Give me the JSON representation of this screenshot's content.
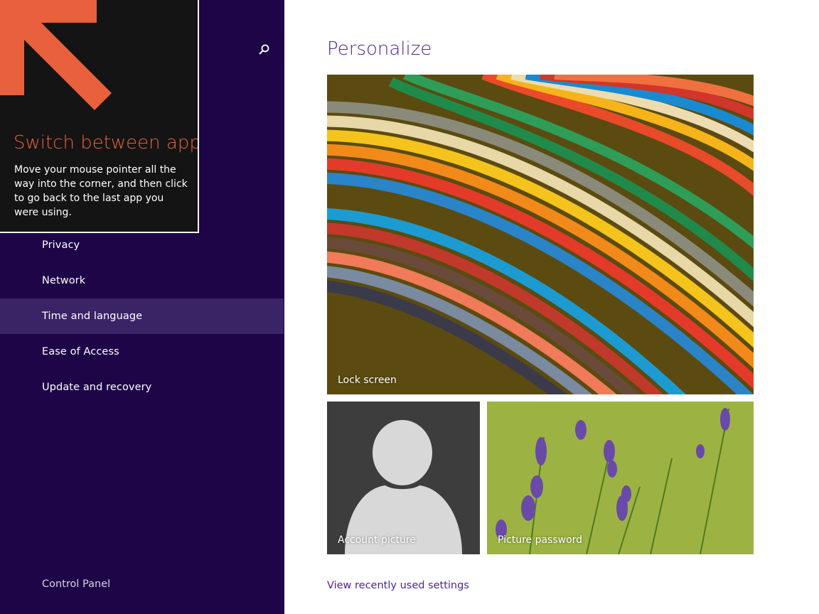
{
  "sidebar": {
    "search_icon": "search-icon",
    "items": [
      {
        "label": "Privacy",
        "selected": false
      },
      {
        "label": "Network",
        "selected": false
      },
      {
        "label": "Time and language",
        "selected": true
      },
      {
        "label": "Ease of Access",
        "selected": false
      },
      {
        "label": "Update and recovery",
        "selected": false
      }
    ],
    "control_panel": "Control Panel"
  },
  "tip": {
    "title": "Switch between apps",
    "body": "Move your mouse pointer all the way into the corner, and then click to go back to the last app you were using.",
    "arrow_icon": "arrow-up-left-icon"
  },
  "main": {
    "title": "Personalize",
    "tiles": {
      "lock_screen": "Lock screen",
      "account_picture": "Account picture",
      "picture_password": "Picture password"
    },
    "recent_link": "View recently used settings"
  },
  "colors": {
    "sidebar_bg": "#1e0548",
    "selected_bg": "#3a2466",
    "accent": "#4b2597",
    "tip_title": "#e8603c"
  }
}
